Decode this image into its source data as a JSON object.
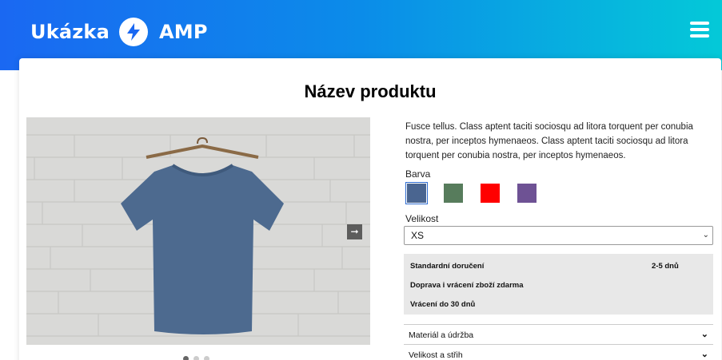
{
  "header": {
    "brand_left": "Ukázka",
    "brand_right": "AMP",
    "background_gradient": [
      "#1a68f2",
      "#04c9d8"
    ],
    "icons": {
      "logo": "lightning-bolt-icon",
      "menu": "hamburger-menu-icon"
    }
  },
  "product": {
    "title": "Název produktu",
    "description": "Fusce tellus. Class aptent taciti sociosqu ad litora torquent per conubia nostra, per inceptos hymenaeos. Class aptent taciti sociosqu ad litora torquent per conubia nostra, per inceptos hymenaeos.",
    "carousel": {
      "slides": 3,
      "active_slide": 1,
      "next_icon": "arrow-right-icon"
    },
    "color_label": "Barva",
    "colors": [
      {
        "hex": "#4a6590",
        "selected": true
      },
      {
        "hex": "#577c5c",
        "selected": false
      },
      {
        "hex": "#ff0000",
        "selected": false
      },
      {
        "hex": "#6e5294",
        "selected": false
      }
    ],
    "size_label": "Velikost",
    "size_selected": "XS",
    "shipping": {
      "row1_label": "Standardní doručení",
      "row1_value": "2-5 dnů",
      "row2_label": "Doprava i vrácení zboží zdarma",
      "row3_label": "Vrácení do 30 dnů"
    },
    "accordion": [
      {
        "label": "Materiál a údržba"
      },
      {
        "label": "Velikost a střih"
      }
    ]
  }
}
